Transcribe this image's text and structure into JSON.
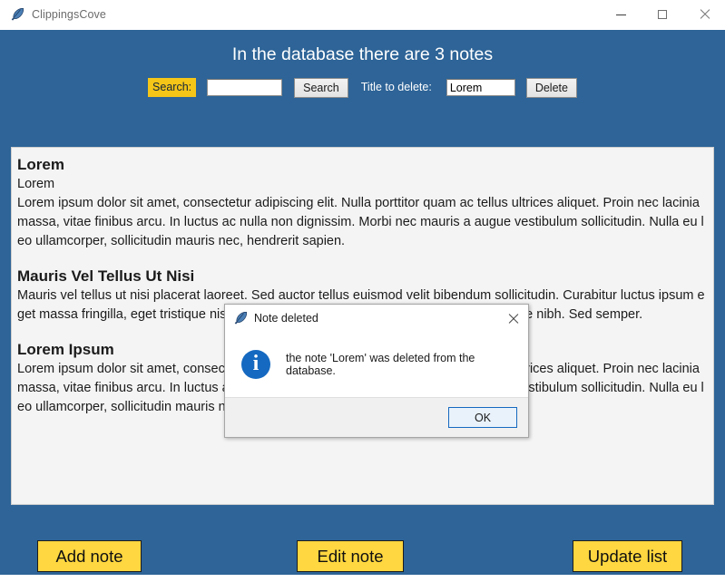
{
  "titlebar": {
    "app_name": "ClippingsCove",
    "icon": "feather-icon",
    "minimize": "minimize-icon",
    "maximize": "maximize-icon",
    "close": "close-icon"
  },
  "header": {
    "title": "In the database there are 3 notes"
  },
  "toolbar": {
    "search_label": "Search:",
    "search_value": "",
    "search_placeholder": "",
    "search_button": "Search",
    "delete_label": "Title to delete:",
    "delete_value": "Lorem",
    "delete_placeholder": "",
    "delete_button": "Delete"
  },
  "notes": [
    {
      "title": "Lorem",
      "subtitle": "Lorem",
      "body": "Lorem ipsum dolor sit amet, consectetur adipiscing elit. Nulla porttitor quam ac tellus ultrices aliquet. Proin nec lacinia massa, vitae finibus arcu. In luctus ac nulla non dignissim. Morbi nec mauris a augue vestibulum sollicitudin. Nulla eu leo ullamcorper, sollicitudin mauris nec, hendrerit sapien."
    },
    {
      "title": "Mauris Vel Tellus Ut Nisi",
      "subtitle": "",
      "body": "Mauris vel tellus ut nisi placerat laoreet. Sed auctor tellus euismod velit bibendum sollicitudin. Curabitur luctus ipsum eget massa fringilla, eget tristique nisi condimentum. Nunc at lobortis ante, a pellentesque nibh. Sed semper."
    },
    {
      "title": "Lorem Ipsum",
      "subtitle": "",
      "body": "Lorem ipsum dolor sit amet, consectetur adipiscing elit. Nulla porttitor quam ac tellus ultrices aliquet. Proin nec lacinia massa, vitae finibus arcu. In luctus ac nulla non dignissim. Morbi nec mauris a augue vestibulum sollicitudin. Nulla eu leo ullamcorper, sollicitudin mauris nec, hendrerit sapien."
    }
  ],
  "actions": {
    "add_note": "Add note",
    "edit_note": "Edit note",
    "update_list": "Update list"
  },
  "dialog": {
    "title": "Note deleted",
    "icon": "feather-icon",
    "close": "close-icon",
    "info_icon": "info-icon",
    "info_glyph": "i",
    "message": "the note 'Lorem' was deleted from the database.",
    "ok_button": "OK"
  },
  "colors": {
    "app_background": "#2e6497",
    "accent_yellow": "#ffd740",
    "search_label_yellow": "#f5c518",
    "panel_background": "#f4f4f4",
    "info_blue": "#1569c0"
  }
}
